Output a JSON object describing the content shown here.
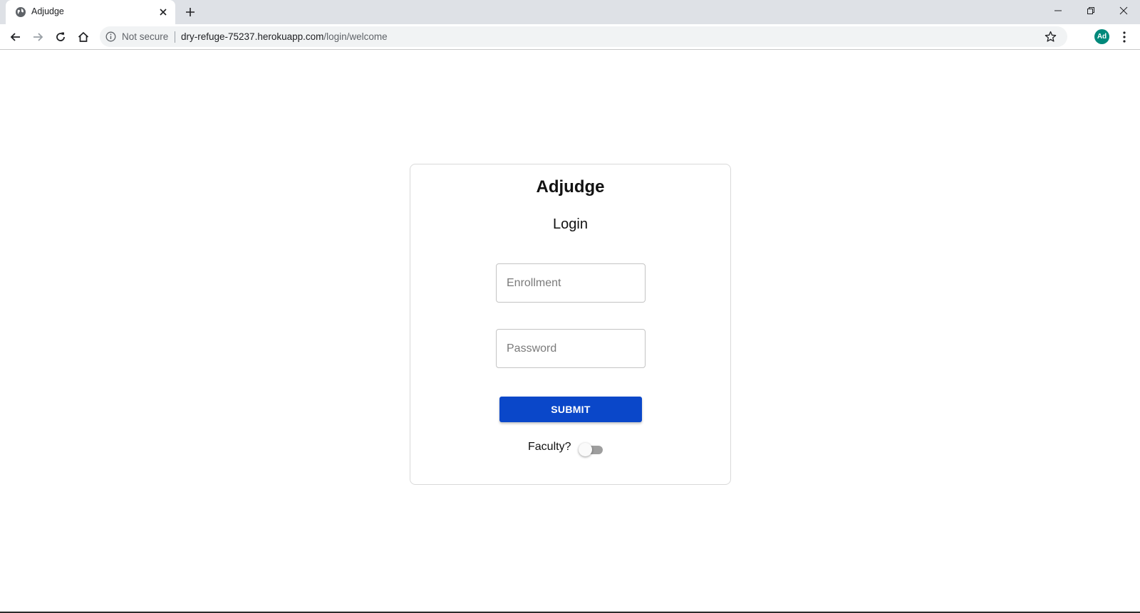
{
  "browser": {
    "tab_title": "Adjudge",
    "security_label": "Not secure",
    "url_host": "dry-refuge-75237.herokuapp.com",
    "url_path": "/login/welcome",
    "profile_initials": "Ad",
    "profile_color": "#00897b"
  },
  "login": {
    "app_title": "Adjudge",
    "heading": "Login",
    "enrollment_placeholder": "Enrollment",
    "enrollment_value": "",
    "password_placeholder": "Password",
    "password_value": "",
    "submit_label": "SUBMIT",
    "faculty_label": "Faculty?",
    "faculty_toggle_on": false,
    "submit_color": "#0a47c9"
  },
  "icons": {
    "tab_favicon": "globe-icon",
    "tab_close": "close-icon",
    "new_tab": "plus-icon",
    "back": "arrow-left-icon",
    "forward": "arrow-right-icon",
    "reload": "reload-icon",
    "home": "home-icon",
    "info": "info-icon",
    "bookmark": "star-icon",
    "menu": "kebab-menu-icon"
  }
}
